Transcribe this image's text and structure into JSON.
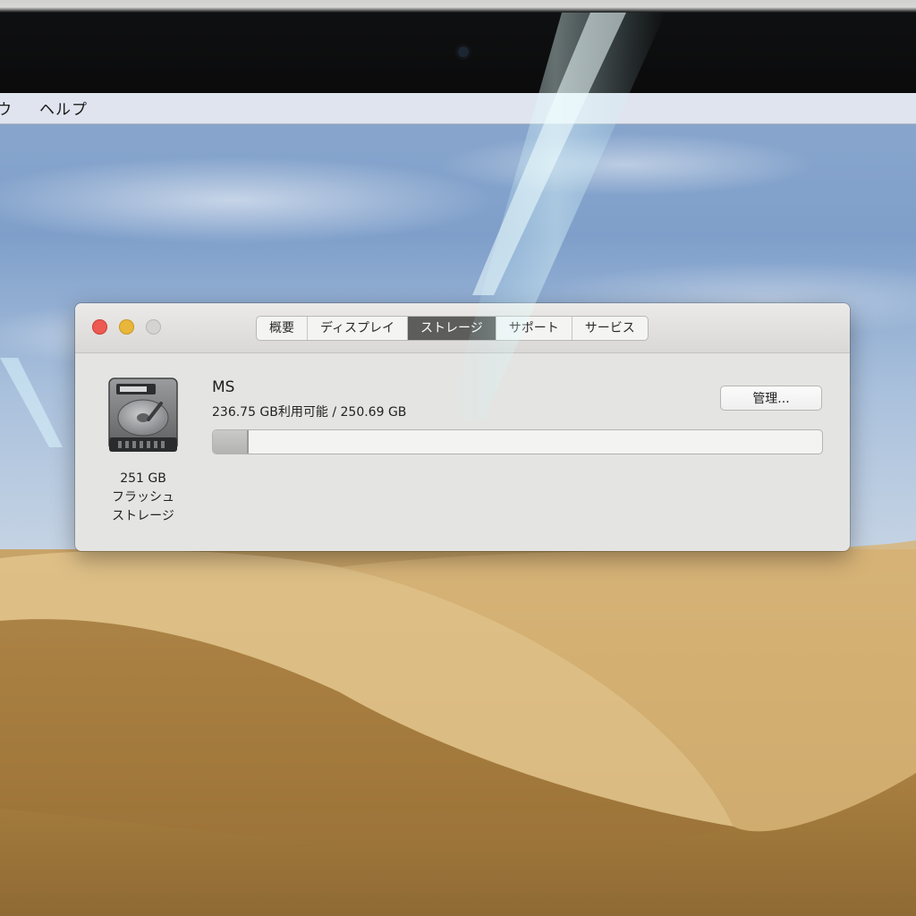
{
  "menubar": {
    "items": [
      "ウ",
      "ヘルプ"
    ]
  },
  "window": {
    "tabs": [
      {
        "label": "概要",
        "active": false
      },
      {
        "label": "ディスプレイ",
        "active": false
      },
      {
        "label": "ストレージ",
        "active": true
      },
      {
        "label": "サポート",
        "active": false
      },
      {
        "label": "サービス",
        "active": false
      }
    ],
    "manage_button": "管理...",
    "drive": {
      "name": "MS",
      "capacity_text": "236.75 GB利用可能 / 250.69 GB",
      "size_label": "251 GB",
      "type_label_line1": "フラッシュ",
      "type_label_line2": "ストレージ",
      "used_fraction": 0.056
    }
  },
  "colors": {
    "close": "#ec5a52",
    "minimize": "#e8b63a",
    "zoom_disabled": "#d4d3d1",
    "active_tab": "#5d5d5c"
  },
  "icons": {
    "disk": "hard-drive-icon"
  }
}
